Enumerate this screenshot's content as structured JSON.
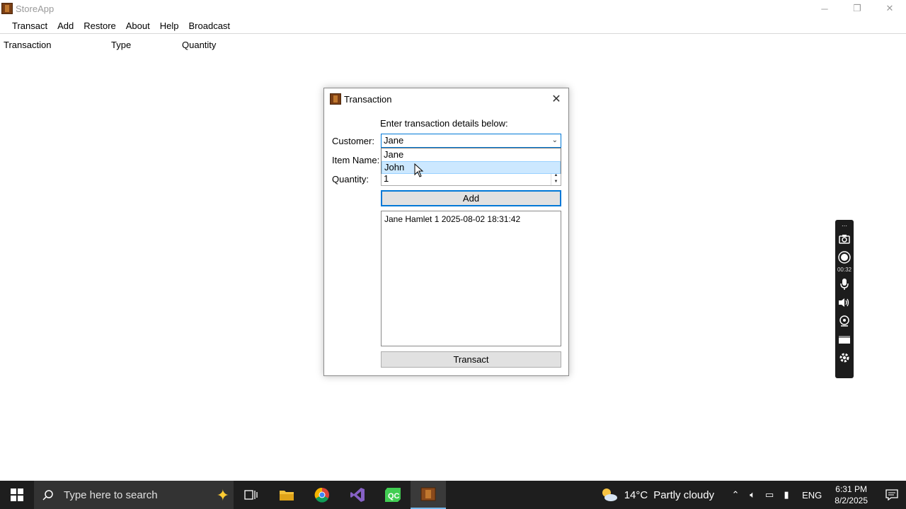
{
  "app": {
    "title": "StoreApp",
    "window_controls": {
      "minimize": "─",
      "maximize": "❐",
      "close": "✕"
    },
    "menu": [
      "Transact",
      "Add",
      "Restore",
      "About",
      "Help",
      "Broadcast"
    ],
    "columns": [
      "Transaction",
      "Type",
      "Quantity"
    ]
  },
  "dialog": {
    "title": "Transaction",
    "close_glyph": "✕",
    "instruction": "Enter transaction details below:",
    "customer_label": "Customer:",
    "customer_value": "Jane",
    "dropdown_options": [
      "Jane",
      "John"
    ],
    "hovered_option": "John",
    "item_label": "Item Name:",
    "quantity_label": "Quantity:",
    "quantity_value": "1",
    "add_label": "Add",
    "log_lines": [
      "Jane Hamlet 1 2025-08-02 18:31:42"
    ],
    "transact_label": "Transact"
  },
  "recorder": {
    "time": "00:32",
    "icons": [
      "camera-icon",
      "record-icon",
      "microphone-icon",
      "speaker-icon",
      "webcam-icon",
      "window-icon",
      "gear-icon"
    ]
  },
  "taskbar": {
    "search_placeholder": "Type here to search",
    "apps": [
      "task-view-icon",
      "file-explorer-icon",
      "chrome-icon",
      "visual-studio-icon",
      "qt-creator-icon",
      "storeapp-icon"
    ],
    "weather_temp": "14°C",
    "weather_desc": "Partly cloudy",
    "language": "ENG",
    "time": "6:31 PM",
    "date": "8/2/2025",
    "colors": {
      "accent": "#0078d7",
      "taskbar": "#1e1e1e",
      "hover": "#cce8ff"
    }
  }
}
